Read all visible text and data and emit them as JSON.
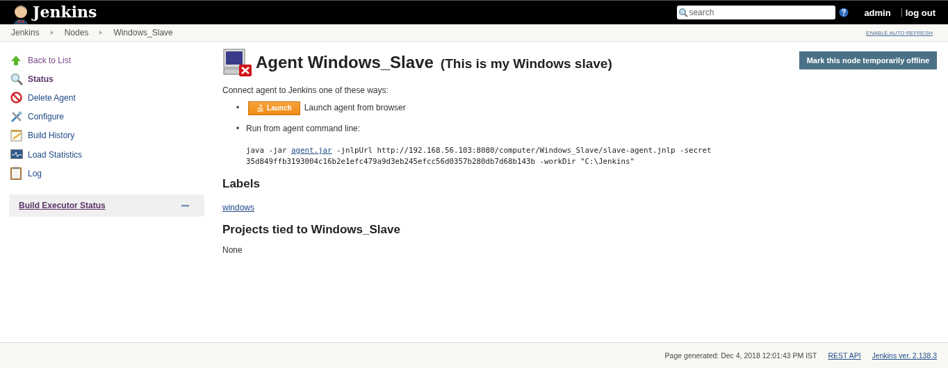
{
  "header": {
    "logo_text": "Jenkins",
    "search": {
      "placeholder": "search"
    },
    "user": "admin",
    "logout": "log out"
  },
  "breadcrumbs": [
    "Jenkins",
    "Nodes",
    "Windows_Slave"
  ],
  "auto_refresh": "ENABLE AUTO REFRESH",
  "sidebar": {
    "items": [
      {
        "label": "Back to List",
        "kind": "up",
        "selected": false,
        "visited": true
      },
      {
        "label": "Status",
        "kind": "search",
        "selected": true,
        "visited": false
      },
      {
        "label": "Delete Agent",
        "kind": "delete",
        "selected": false,
        "visited": false
      },
      {
        "label": "Configure",
        "kind": "tools",
        "selected": false,
        "visited": false
      },
      {
        "label": "Build History",
        "kind": "notepad",
        "selected": false,
        "visited": false
      },
      {
        "label": "Load Statistics",
        "kind": "monitor",
        "selected": false,
        "visited": false
      },
      {
        "label": "Log",
        "kind": "clipboard",
        "selected": false,
        "visited": false
      }
    ],
    "panel": {
      "title": "Build Executor Status",
      "expanded": true
    }
  },
  "main": {
    "offline_button": "Mark this node temporarily offline",
    "title": "Agent Windows_Slave",
    "description": "(This is my Windows slave)",
    "offline": true,
    "intro": "Connect agent to Jenkins one of these ways:",
    "bullet": "•",
    "launch_button": "Launch",
    "launch_text": "Launch agent from browser",
    "cmd_intro": "Run from agent command line:",
    "command": {
      "before": "java -jar ",
      "link": "agent.jar",
      "after": " -jnlpUrl http://192.168.56.103:8080/computer/Windows_Slave/slave-agent.jnlp -secret",
      "line2": "35d849ffb3193004c16b2e1efc479a9d3eb245efcc56d0357b280db7d68b143b -workDir \"C:\\Jenkins\""
    },
    "labels_heading": "Labels",
    "labels": [
      "windows"
    ],
    "projects_heading": "Projects tied to Windows_Slave",
    "projects_text": "None"
  },
  "footer": {
    "generated": "Page generated: Dec 4, 2018 12:01:43 PM IST",
    "rest_api": "REST API",
    "version": "Jenkins ver. 2.138.3"
  }
}
